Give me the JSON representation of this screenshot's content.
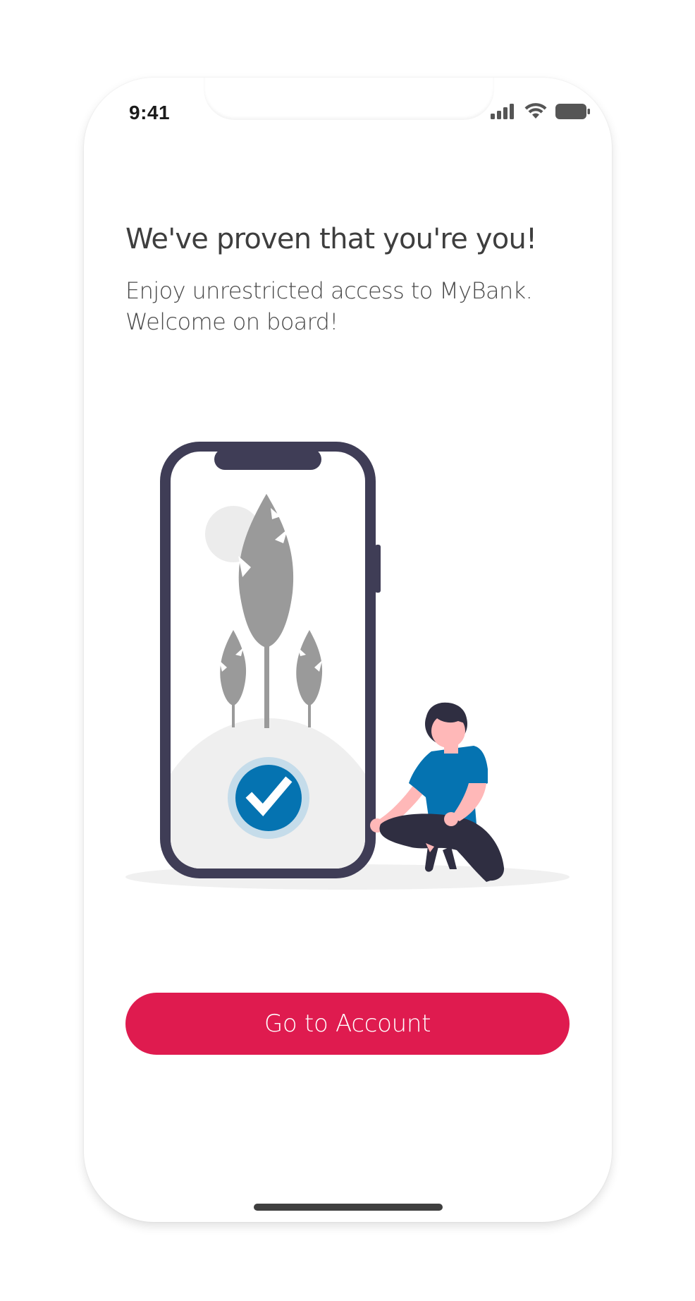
{
  "status_bar": {
    "time": "9:41",
    "icons": [
      "signal-icon",
      "wifi-icon",
      "battery-icon"
    ]
  },
  "content": {
    "title": "We've proven that you're you!",
    "subtitle_line1": "Enjoy unrestricted access to MyBank.",
    "subtitle_line2": "Welcome on board!"
  },
  "illustration": {
    "name": "verified-identity-illustration",
    "status": "verified"
  },
  "cta": {
    "label": "Go to Account"
  },
  "colors": {
    "accent": "#df1b4f",
    "check_badge": "#0573b1",
    "text_primary": "#3e3e3e",
    "phone_frame": "#3f3d56"
  }
}
